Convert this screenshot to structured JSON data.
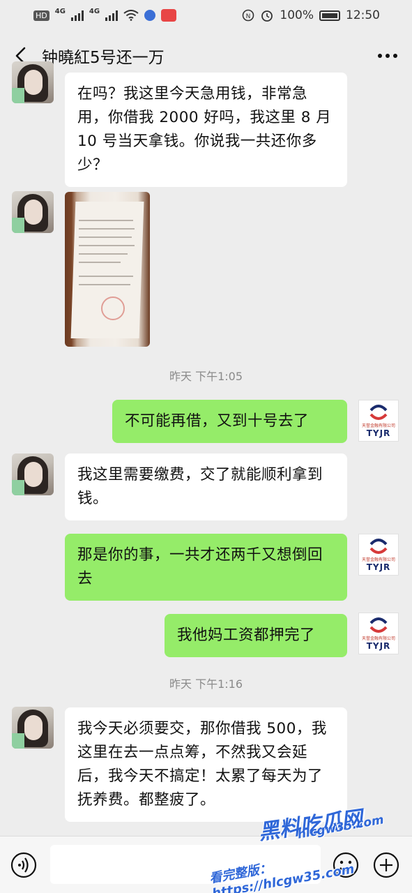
{
  "status_bar": {
    "carrier_tag": "HD",
    "network_1": "4G",
    "network_2": "4G",
    "battery_percent": "100%",
    "time": "12:50"
  },
  "header": {
    "title": "钟曉紅5号还一万"
  },
  "messages": [
    {
      "side": "in",
      "text": "在吗？我这里今天急用钱，非常急用，你借我 2000 好吗，我这里 8 月 10 号当天拿钱。你说我一共还你多少？"
    },
    {
      "side": "in",
      "type": "image",
      "icon": "document-photo"
    },
    {
      "type": "time",
      "text": "昨天 下午1:05"
    },
    {
      "side": "out",
      "text": "不可能再借，又到十号去了"
    },
    {
      "side": "in",
      "text": "我这里需要缴费，交了就能顺利拿到钱。"
    },
    {
      "side": "out",
      "text": "那是你的事，一共才还两千又想倒回去"
    },
    {
      "side": "out",
      "text": "我他妈工资都押完了"
    },
    {
      "type": "time",
      "text": "昨天 下午1:16"
    },
    {
      "side": "in",
      "text": "我今天必须要交，那你借我 500，我这里在去一点点筹，不然我又会延后，我今天不搞定！太累了每天为了抚养费。都整疲了。"
    }
  ],
  "avatars": {
    "self_logo_text": "TYJR",
    "self_logo_cn": "天誉金融有限公司"
  },
  "input": {
    "placeholder": ""
  },
  "watermark": {
    "main": "黑料吃瓜网",
    "url": "hlcgw35.com",
    "bottom": "看完整版：https://hlcgw35.com"
  },
  "colors": {
    "background": "#ededed",
    "bubble_in": "#ffffff",
    "bubble_out": "#95ec69",
    "watermark": "#2f67d8"
  }
}
